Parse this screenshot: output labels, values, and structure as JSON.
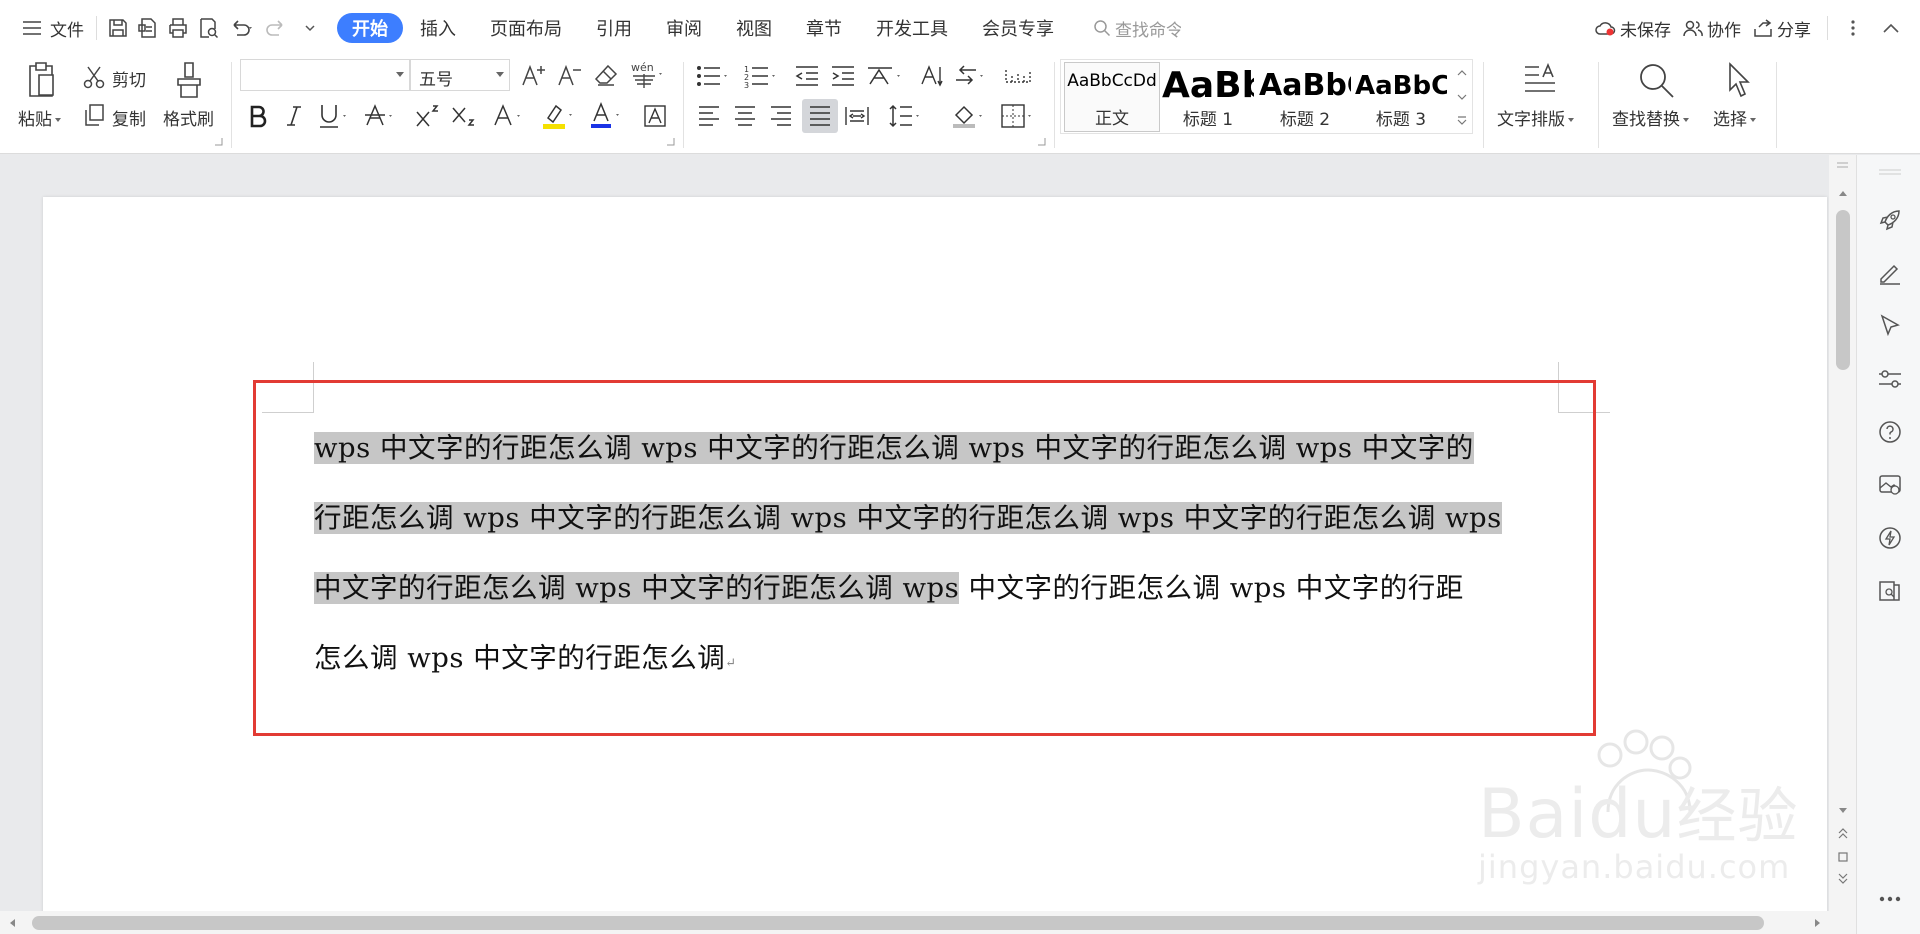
{
  "menu": {
    "file_label": "文件",
    "tabs": [
      "开始",
      "插入",
      "页面布局",
      "引用",
      "审阅",
      "视图",
      "章节",
      "开发工具",
      "会员专享"
    ],
    "search_placeholder": "查找命令",
    "unsaved_label": "未保存",
    "collab_label": "协作",
    "share_label": "分享"
  },
  "ribbon": {
    "paste_label": "粘贴",
    "cut_label": "剪切",
    "copy_label": "复制",
    "format_painter_label": "格式刷",
    "font_name": "",
    "font_size": "五号",
    "styles": [
      {
        "preview": "AaBbCcDd",
        "name": "正文"
      },
      {
        "preview": "AaBb",
        "name": "标题 1"
      },
      {
        "preview": "AaBbC",
        "name": "标题 2"
      },
      {
        "preview": "AaBbCc",
        "name": "标题 3"
      }
    ],
    "text_layout_label": "文字排版",
    "find_replace_label": "查找替换",
    "select_label": "选择"
  },
  "document": {
    "lines": [
      {
        "selected": "wps 中文字的行距怎么调 wps 中文字的行距怎么调 wps 中文字的行距怎么调 wps 中文字的",
        "rest": ""
      },
      {
        "selected": "行距怎么调 wps 中文字的行距怎么调 wps 中文字的行距怎么调 wps 中文字的行距怎么调 wps",
        "rest": ""
      },
      {
        "selected": "中文字的行距怎么调 wps 中文字的行距怎么调 wps",
        "rest": " 中文字的行距怎么调 wps 中文字的行距"
      },
      {
        "selected": "",
        "rest": "怎么调 wps 中文字的行距怎么调"
      }
    ],
    "paragraph_mark": "↵"
  },
  "watermark": {
    "brand": "Baidu",
    "cn": "经验",
    "url": "jingyan.baidu.com"
  },
  "colors": {
    "accent": "#3d7eff",
    "selection": "#c6c6c6",
    "annotation_box": "#e23b34"
  }
}
